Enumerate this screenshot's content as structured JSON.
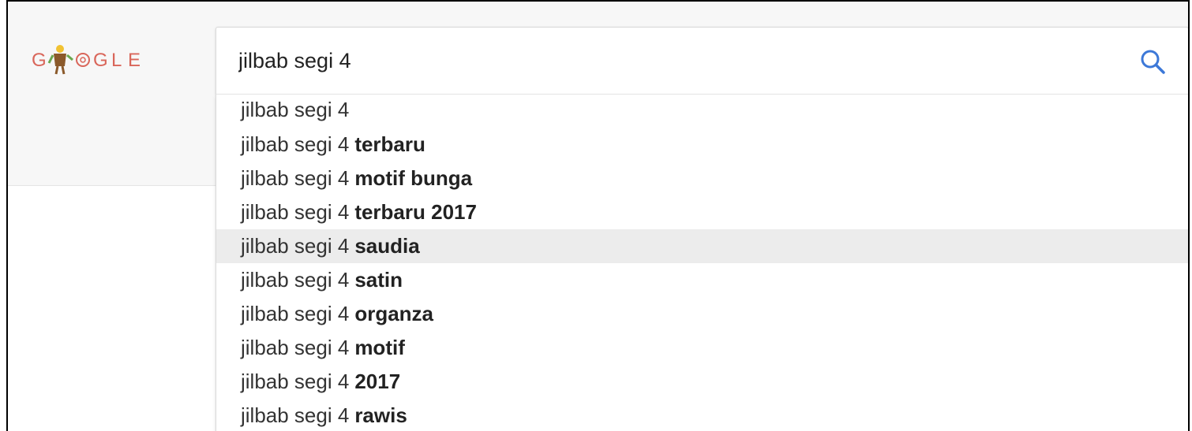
{
  "logo": {
    "letters": [
      "G",
      "O",
      "G",
      "L",
      "E"
    ],
    "colors": {
      "letter": "#d9665a",
      "figure_body": "#8b5a2b",
      "figure_accent": "#6aa84f",
      "figure_head": "#f1c232"
    }
  },
  "search": {
    "query": "jilbab segi 4",
    "icon": "search-icon",
    "icon_color": "#3c78d8"
  },
  "suggestions": [
    {
      "prefix": "jilbab segi 4",
      "completion": ""
    },
    {
      "prefix": "jilbab segi 4",
      "completion": "terbaru"
    },
    {
      "prefix": "jilbab segi 4",
      "completion": "motif bunga"
    },
    {
      "prefix": "jilbab segi 4",
      "completion": "terbaru 2017"
    },
    {
      "prefix": "jilbab segi 4",
      "completion": "saudia",
      "highlighted": true
    },
    {
      "prefix": "jilbab segi 4",
      "completion": "satin"
    },
    {
      "prefix": "jilbab segi 4",
      "completion": "organza"
    },
    {
      "prefix": "jilbab segi 4",
      "completion": "motif"
    },
    {
      "prefix": "jilbab segi 4",
      "completion": "2017"
    },
    {
      "prefix": "jilbab segi 4",
      "completion": "rawis"
    }
  ]
}
